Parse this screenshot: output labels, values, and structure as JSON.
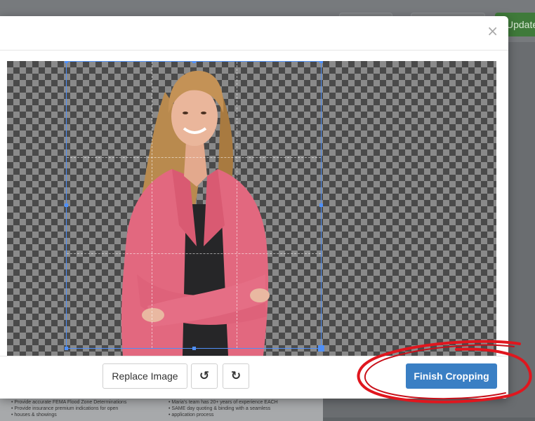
{
  "background": {
    "update_label": "Update",
    "doc_col1": [
      "Provide accurate FEMA Flood Zone Determinations",
      "Provide insurance premium indications for open",
      "houses & showings"
    ],
    "doc_col2": [
      "Maria's team has 20+ years of experience EACH",
      "SAME day quoting & binding with a seamless",
      "application process"
    ]
  },
  "modal": {
    "close_symbol": "×",
    "footer": {
      "replace_label": "Replace Image",
      "rotate_left_symbol": "↺",
      "rotate_right_symbol": "↻",
      "finish_label": "Finish Cropping"
    }
  },
  "colors": {
    "primary": "#3a7fc4",
    "crop_border": "#4f8ff7",
    "annotation": "#e0161e"
  },
  "icons": [
    "close-icon",
    "rotate-left-icon",
    "rotate-right-icon"
  ]
}
